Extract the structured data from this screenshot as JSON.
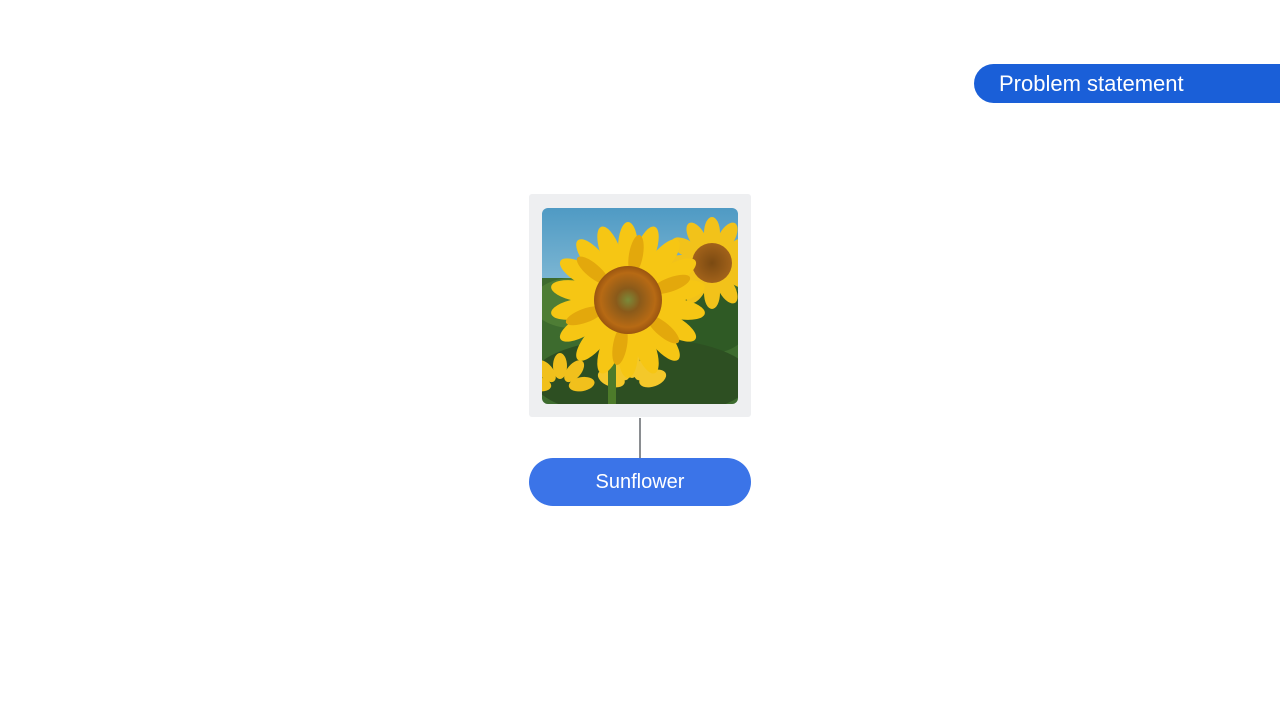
{
  "header": {
    "section_label": "Problem statement"
  },
  "diagram": {
    "image": {
      "subject": "sunflower field photo"
    },
    "class_label": "Sunflower"
  },
  "colors": {
    "accent": "#1a5fd8",
    "pill": "#3b74e8",
    "card": "#eeeff1",
    "connector": "#8a8d91"
  }
}
